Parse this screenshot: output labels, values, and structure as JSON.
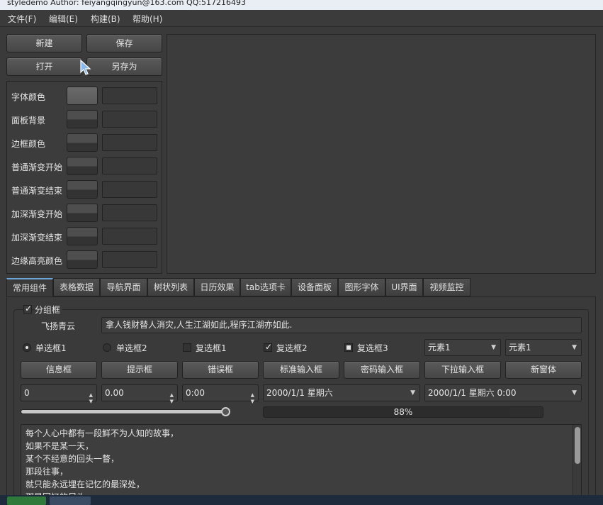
{
  "window": {
    "title": "styledemo  Author: feiyangqingyun@163.com  QQ:517216493"
  },
  "menu": {
    "items": [
      "文件(F)",
      "编辑(E)",
      "构建(B)",
      "帮助(H)"
    ]
  },
  "top_buttons": {
    "new": "新建",
    "save": "保存",
    "open": "打开",
    "save_as": "另存为"
  },
  "color_settings": {
    "rows": [
      "字体颜色",
      "面板背景",
      "边框颜色",
      "普通渐变开始",
      "普通渐变结束",
      "加深渐变开始",
      "加深渐变结束",
      "边缘高亮颜色"
    ]
  },
  "tabs": [
    "常用组件",
    "表格数据",
    "导航界面",
    "树状列表",
    "日历效果",
    "tab选项卡",
    "设备面板",
    "图形字体",
    "UI界面",
    "视频监控"
  ],
  "active_tab": 0,
  "group": {
    "title": "分组框",
    "label": "飞扬青云",
    "line_edit": "拿人钱财替人消灾,人生江湖如此,程序江湖亦如此.",
    "radio1": "单选框1",
    "radio2": "单选框2",
    "check1": "复选框1",
    "check2": "复选框2",
    "check3": "复选框3",
    "combo1": "元素1",
    "combo2": "元素1",
    "buttons": [
      "信息框",
      "提示框",
      "错误框",
      "标准输入框",
      "密码输入框",
      "下拉输入框",
      "新窗体"
    ],
    "spin_int": "0",
    "spin_double": "0.00",
    "time_edit": "0:00",
    "date_edit": "2000/1/1 星期六",
    "datetime_edit": "2000/1/1 星期六 0:00",
    "slider_value": 1.0,
    "progress_value": 0.88,
    "progress_text": "88%",
    "text_lines": [
      "每个人心中都有一段鲜不为人知的故事，",
      "如果不是某一天，",
      "某个不经意的回头一瞥，",
      "那段往事，",
      "就只能永远埋在记忆的最深处，",
      "那是回忆的尽头"
    ]
  },
  "colors": {
    "accent": "#6aa4d8",
    "background": "#3a3a3a"
  }
}
